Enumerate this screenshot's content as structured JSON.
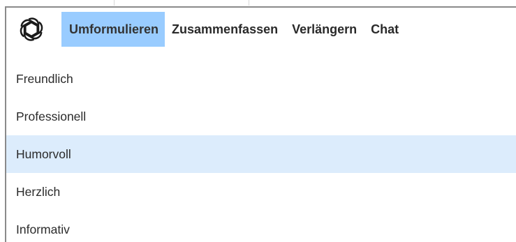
{
  "toolbar": {
    "logo_icon": "openai-knot-icon",
    "tabs": [
      {
        "label": "Umformulieren",
        "active": true
      },
      {
        "label": "Zusammenfassen",
        "active": false
      },
      {
        "label": "Verlängern",
        "active": false
      },
      {
        "label": "Chat",
        "active": false
      }
    ]
  },
  "menu": {
    "items": [
      {
        "label": "Freundlich",
        "highlighted": false
      },
      {
        "label": "Professionell",
        "highlighted": false
      },
      {
        "label": "Humorvoll",
        "highlighted": true
      },
      {
        "label": "Herzlich",
        "highlighted": false
      },
      {
        "label": "Informativ",
        "highlighted": false
      }
    ]
  },
  "colors": {
    "active_tab_bg": "#99ccff",
    "highlight_row_bg": "#dcecfc",
    "panel_border": "#8a8a8a"
  }
}
